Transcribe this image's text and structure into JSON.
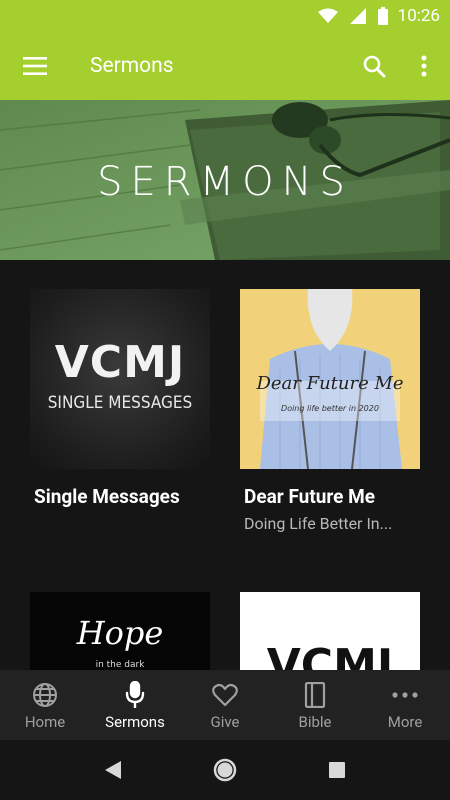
{
  "status_bar": {
    "time": "10:26",
    "icons": [
      "wifi-icon",
      "signal-icon",
      "battery-icon"
    ]
  },
  "app_bar": {
    "title": "Sermons",
    "menu_icon": "hamburger-menu-icon",
    "search_icon": "search-icon",
    "overflow_icon": "more-vertical-icon"
  },
  "banner": {
    "title": "SERMONS"
  },
  "cards": [
    {
      "title": "Single Messages",
      "subtitle": "",
      "thumb_text_1": "VCMJ",
      "thumb_text_2": "SINGLE MESSAGES"
    },
    {
      "title": "Dear Future Me",
      "subtitle": "Doing Life Better In...",
      "thumb_text_1": "Dear Future Me",
      "thumb_text_2": "Doing life better in 2020"
    },
    {
      "title": "",
      "subtitle": "",
      "thumb_text_1": "Hope",
      "thumb_text_2": "in the dark"
    },
    {
      "title": "",
      "subtitle": "",
      "thumb_text_1": "VCMJ",
      "thumb_text_2": ""
    }
  ],
  "bottom_nav": {
    "items": [
      {
        "label": "Home",
        "icon": "globe-icon",
        "active": false
      },
      {
        "label": "Sermons",
        "icon": "microphone-icon",
        "active": true
      },
      {
        "label": "Give",
        "icon": "heart-icon",
        "active": false
      },
      {
        "label": "Bible",
        "icon": "book-icon",
        "active": false
      },
      {
        "label": "More",
        "icon": "more-horizontal-icon",
        "active": false
      }
    ]
  },
  "system_nav": {
    "back": "back-icon",
    "home": "home-circle-icon",
    "recents": "recents-square-icon"
  },
  "colors": {
    "accent": "#a4cf2f",
    "background": "#151515",
    "nav_bg": "#222222"
  }
}
